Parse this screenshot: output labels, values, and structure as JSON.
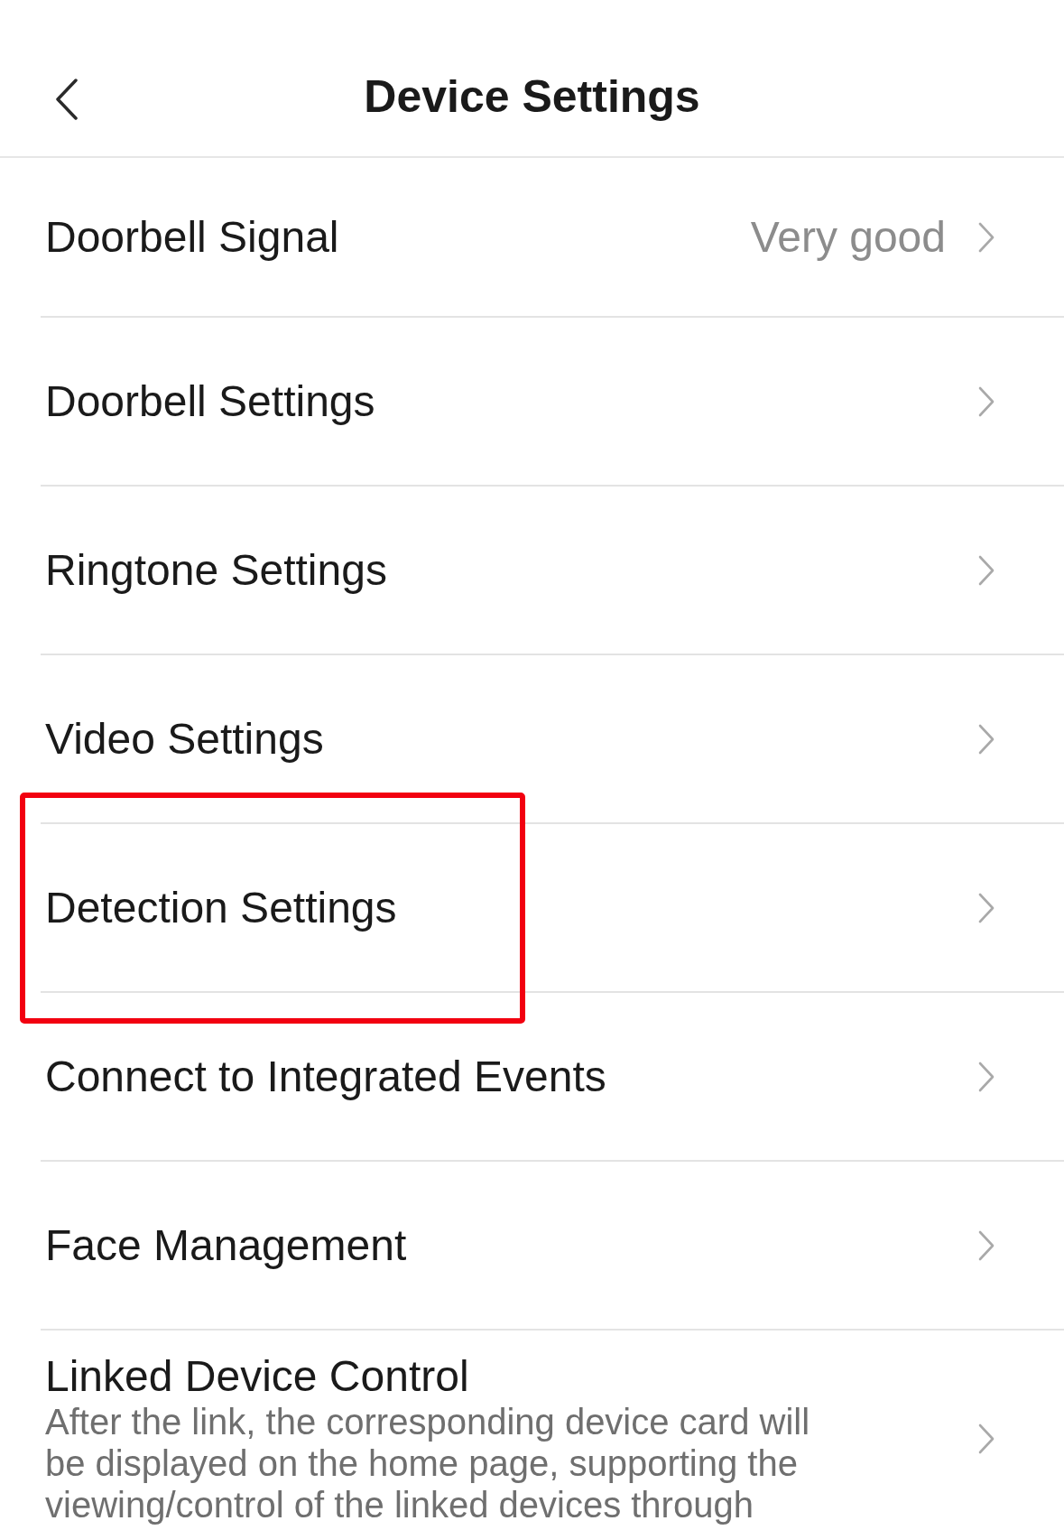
{
  "header": {
    "title": "Device Settings"
  },
  "rows": [
    {
      "label": "Doorbell Signal",
      "value": "Very good",
      "highlighted": false
    },
    {
      "label": "Doorbell Settings",
      "highlighted": false
    },
    {
      "label": "Ringtone Settings",
      "highlighted": false
    },
    {
      "label": "Video Settings",
      "highlighted": false
    },
    {
      "label": "Detection Settings",
      "highlighted": true
    },
    {
      "label": "Connect to Integrated Events",
      "highlighted": false
    },
    {
      "label": "Face Management",
      "highlighted": false
    },
    {
      "label": "Linked Device Control",
      "description": "After the link, the corresponding device card will be displayed on the home page, supporting the viewing/control of the linked devices through",
      "highlighted": false
    }
  ]
}
